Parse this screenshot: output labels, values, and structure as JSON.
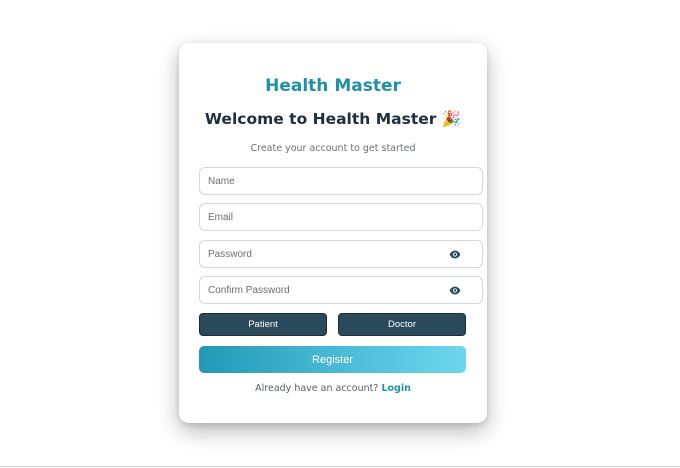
{
  "header": {
    "brand": "Health Master",
    "welcome": "Welcome to Health Master 🎉",
    "subtitle": "Create your account to get started"
  },
  "form": {
    "name_placeholder": "Name",
    "email_placeholder": "Email",
    "password_placeholder": "Password",
    "confirm_password_placeholder": "Confirm Password",
    "icons": {
      "password_toggle": "eye-icon",
      "confirm_toggle": "eye-icon"
    }
  },
  "roles": {
    "patient_label": "Patient",
    "doctor_label": "Doctor"
  },
  "actions": {
    "register_label": "Register"
  },
  "footer": {
    "prompt": "Already have an account?",
    "login_label": "Login"
  },
  "colors": {
    "brand": "#2190a8",
    "role_button": "#2a4a5c",
    "register_gradient_start": "#2199b5",
    "register_gradient_end": "#6ed6ec"
  }
}
